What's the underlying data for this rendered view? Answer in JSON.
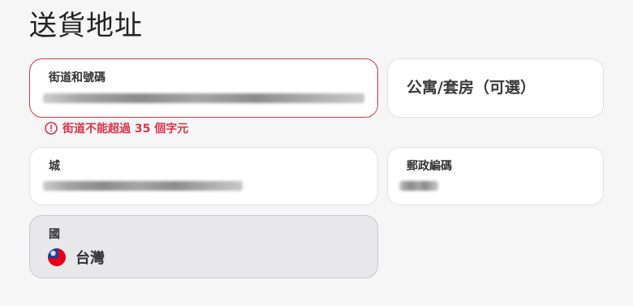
{
  "section": {
    "title": "送貨地址"
  },
  "street": {
    "label": "街道和號碼",
    "value_redacted": true,
    "error": "街道不能超過 35 個字元"
  },
  "apartment": {
    "placeholder": "公寓/套房（可選）"
  },
  "city": {
    "label": "城",
    "value_redacted": true
  },
  "postal_code": {
    "label": "郵政編碼",
    "value_redacted": true
  },
  "country": {
    "label": "國",
    "value": "台灣",
    "flag_icon": "taiwan-flag-icon",
    "disabled": true
  },
  "colors": {
    "error": "#d8364a",
    "background": "#f6f6f7",
    "field_background": "#ffffff",
    "disabled_background": "#e8e8eb"
  }
}
